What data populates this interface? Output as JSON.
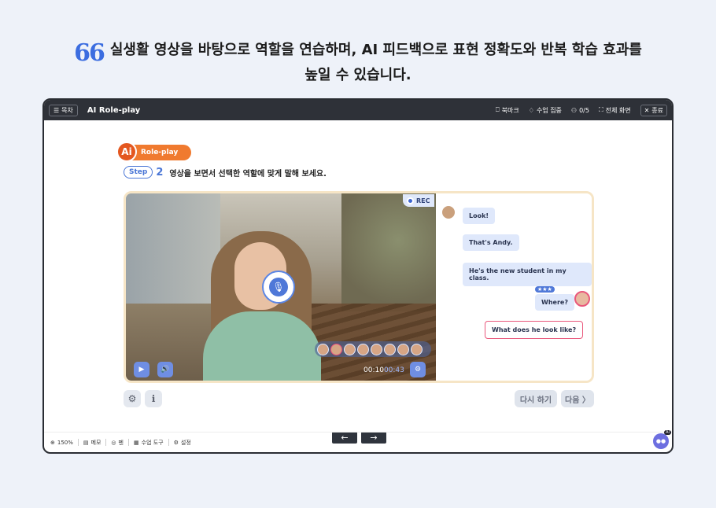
{
  "headline": {
    "quote_mark": "66",
    "line1": "실생활 영상을 바탕으로 역할을 연습하며, AI 피드백으로 표현 정확도와 반복 학습 효과를",
    "line2": "높일 수 있습니다."
  },
  "topbar": {
    "toc_label": "목차",
    "title": "AI Role-play",
    "bookmark": "북마크",
    "focus": "수업 집중",
    "progress": "0/5",
    "fullscreen": "전체 화면",
    "close": "종료"
  },
  "activity": {
    "logo_ai": "Ai",
    "logo_label": "Role-play",
    "step_label": "Step",
    "step_number": "2",
    "instruction": "영상을 보면서 선택한 역할에 맞게 말해 보세요."
  },
  "video": {
    "rec_label": "REC",
    "time_current": "00:10",
    "time_total": "00:43"
  },
  "chat": {
    "messages": [
      {
        "text": "Look!",
        "side": "left"
      },
      {
        "text": "That's Andy.",
        "side": "left"
      },
      {
        "text": "He's the new student in my class.",
        "side": "left"
      },
      {
        "text": "Where?",
        "side": "right",
        "stars": "★★★"
      },
      {
        "text": "What does he look like?",
        "side": "right",
        "active": true
      }
    ]
  },
  "actions": {
    "retry": "다시 하기",
    "next": "다음 〉"
  },
  "bottombar": {
    "zoom": "150%",
    "memo": "메모",
    "pen": "펜",
    "tools": "수업 도구",
    "settings": "설정",
    "ai_tag": "AI"
  },
  "colors": {
    "accent": "#4f78d8",
    "brand_orange": "#f07a2f",
    "active_pink": "#e9587c"
  }
}
